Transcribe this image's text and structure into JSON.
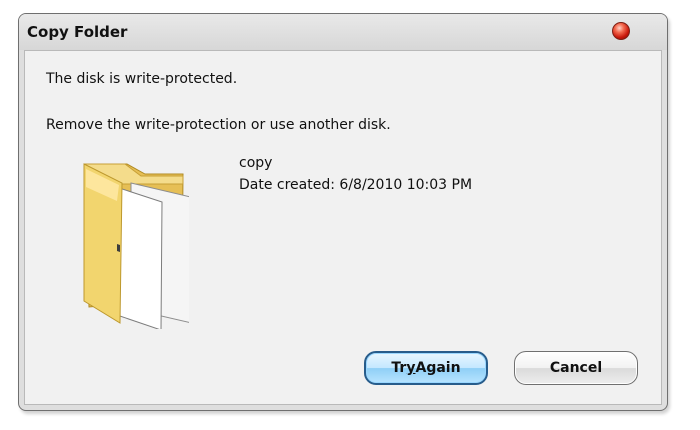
{
  "dialog": {
    "title": "Copy Folder",
    "message_primary": "The disk is write-protected.",
    "message_secondary": "Remove the write-protection or use another disk.",
    "file": {
      "name": "copy",
      "date_created": "Date created: 6/8/2010 10:03 PM"
    },
    "buttons": {
      "try_again_mnemonic": "y",
      "try_again_rest": " Again",
      "try_again_prefix": "Tr",
      "cancel": "Cancel"
    },
    "icons": {
      "close": "close-icon",
      "folder": "folder-icon"
    },
    "colors": {
      "close": "#d01c10",
      "folder": "#f2d56e",
      "default_button": "#8fcff6"
    }
  }
}
